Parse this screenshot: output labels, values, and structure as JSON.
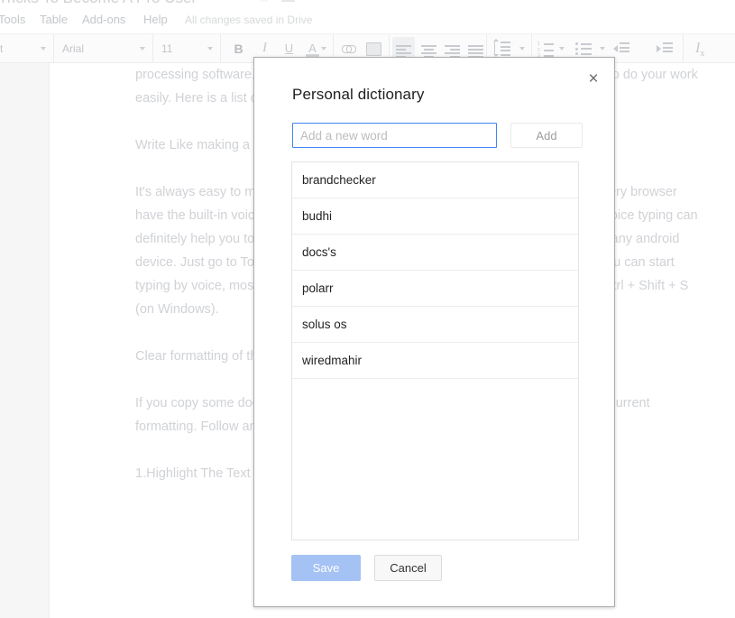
{
  "app": {
    "document_title": "Tricks To Become A Pro User",
    "menu_items": [
      "Tools",
      "Table",
      "Add-ons",
      "Help"
    ],
    "save_status": "All changes saved in Drive"
  },
  "toolbar": {
    "style_value": "text",
    "font_value": "Arial",
    "size_value": "11",
    "bold_label": "B",
    "italic_label": "I",
    "underline_label": "U",
    "text_color_label": "A",
    "clear_format_label": "I",
    "clear_format_sub": "x"
  },
  "document": {
    "paragraphs": [
      "processing software. If you open google then you will see a tons of powerful tools to do your work easily. Here is a list of best google docs tips and tricks for you.",
      "Write Like making a Voice Command",
      "It's always easy to make the command with your voice rather than writing. Now every browser have the built-in voice assistance and voice command functionality. Google docs voice typing can definitely help you to write easily. Google voice typing is built-in into your laptop or any android device. Just go to Tools >> Voice typing. One voice typing panel will appear and you can start typing by voice, mostly in any language. Just press Ctrl + Shift + S (on a Mac) or Ctrl + Shift + S (on Windows).",
      "Clear formatting of the text",
      "If you copy some documents from another source then it may not merger with the current formatting. Follow any step to fix the formatting."
    ],
    "list_item_number": "1.",
    "list_item_text": "Highlight The Text >> Right Click >> Clear Format"
  },
  "dialog": {
    "title": "Personal dictionary",
    "close_label": "×",
    "input_placeholder": "Add a new word",
    "input_value": "",
    "add_label": "Add",
    "words": [
      "brandchecker",
      "budhi",
      "docs's",
      "polarr",
      "solus os",
      "wiredmahir"
    ],
    "save_label": "Save",
    "cancel_label": "Cancel"
  },
  "colors": {
    "accent_blue": "#4285f4",
    "save_disabled": "#a4c2f4",
    "dialog_border": "#acacac",
    "list_border": "#e4e4e4"
  }
}
